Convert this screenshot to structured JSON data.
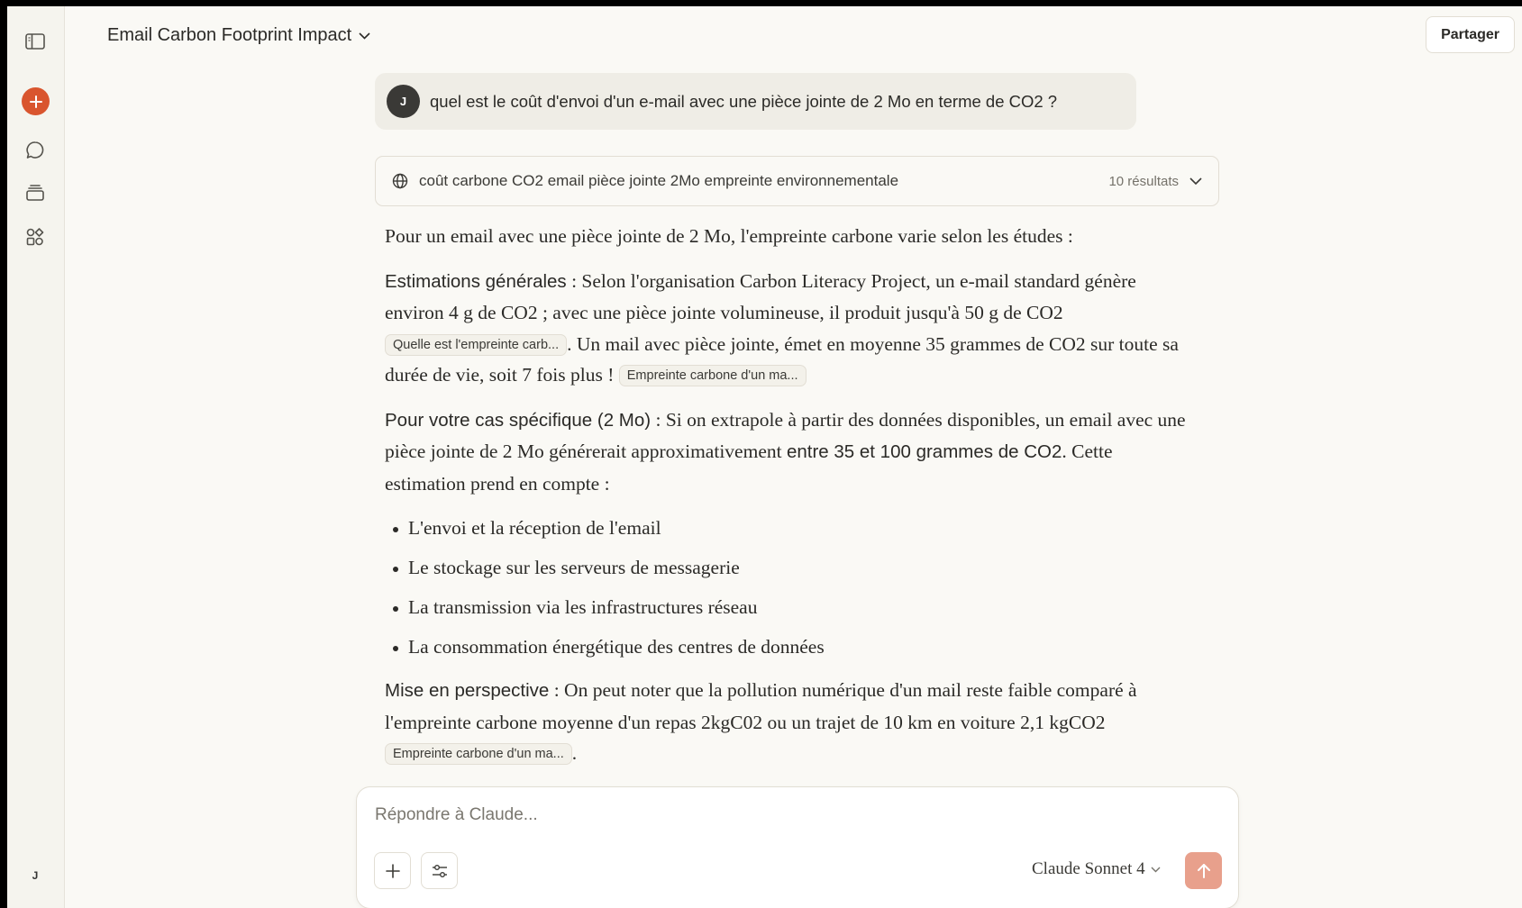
{
  "sidebar": {
    "user_initial": "J"
  },
  "header": {
    "title": "Email Carbon Footprint Impact",
    "share_label": "Partager"
  },
  "user_message": {
    "avatar_initial": "J",
    "text": "quel est le coût d'envoi d'un e-mail avec une pièce jointe de 2 Mo en terme de CO2 ?"
  },
  "search": {
    "query": "coût carbone CO2 email pièce jointe 2Mo empreinte environnementale",
    "results_count": "10 résultats"
  },
  "response": {
    "intro": "Pour un email avec une pièce jointe de 2 Mo, l'empreinte carbone varie selon les études :",
    "p1": {
      "heading": "Estimations générales",
      "text1": " : Selon l'organisation Carbon Literacy Project, un e-mail standard génère environ 4 g de CO2 ; avec une pièce jointe volumineuse, il produit jusqu'à 50 g de CO2 ",
      "cite1": "Quelle est l'empreinte carb...",
      "text2": ". Un mail avec pièce jointe, émet en moyenne 35 grammes de CO2 sur toute sa durée de vie, soit 7 fois plus ! ",
      "cite2": "Empreinte carbone d'un ma..."
    },
    "p2": {
      "heading": "Pour votre cas spécifique (2 Mo)",
      "text1": " : Si on extrapole à partir des données disponibles, un email avec une pièce jointe de 2 Mo générerait approximativement ",
      "bold": "entre 35 et 100 grammes de CO2",
      "text2": ". Cette estimation prend en compte :"
    },
    "bullets": [
      "L'envoi et la réception de l'email",
      "Le stockage sur les serveurs de messagerie",
      "La transmission via les infrastructures réseau",
      "La consommation énergétique des centres de données"
    ],
    "p3": {
      "heading": "Mise en perspective",
      "text1": " : On peut noter que la pollution numérique d'un mail reste faible comparé à l'empreinte carbone moyenne d'un repas 2kgC02 ou un trajet de 10 km en voiture 2,1 kgCO2 ",
      "cite1": "Empreinte carbone d'un ma...",
      "text2": "."
    }
  },
  "composer": {
    "placeholder": "Répondre à Claude...",
    "model": "Claude Sonnet 4"
  },
  "colors": {
    "background": "#faf9f5",
    "accent": "#d9552e",
    "send_disabled": "#e8a08c"
  }
}
